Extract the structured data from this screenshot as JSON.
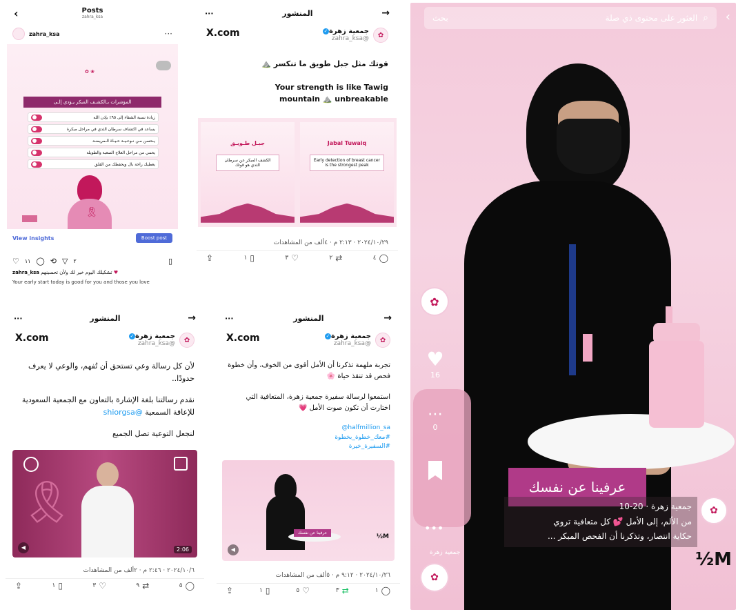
{
  "panel1": {
    "title": "Posts",
    "subtitle": "zahra_ksa",
    "account": "zahra_ksa",
    "banner": "المؤشرات بـالكشـف المبكر يـؤدي إلـى",
    "items": [
      "زيادة نسبة الشفاء إلى ٩٥٪ بإذن الله",
      "يساعد في اكتشاف سرطان الثدي في مراحل مبكرة",
      "يـحسن مـن نـوعـيـة حـيـاة الـمريضـة",
      "يحمي من مراحل العلاج الصعبة والطويلة",
      "يعطيك راحة بال ويحفظك من القلق"
    ],
    "view_insights": "View insights",
    "boost_post": "Boost post",
    "likes": "١١",
    "shares": "٢",
    "caption": "تشكيلك اليوم خير لك ولأن تحسينهم",
    "caption_en": "Your early start today is good for you and those you love"
  },
  "panel2": {
    "header_title": "المنشور",
    "xlogo": "X.com",
    "name": "جمعية زهرة",
    "handle": "@zahra_ksa",
    "text_ar": "قوتك مثل جبل طويق ما تنكسر ⛰️",
    "text_en": "Your strength is like Tawig mountain ⛰️ unbreakable",
    "img_left_title": "جبـل طـويـق",
    "img_right_title": "Jabal Tuwaiq",
    "img_left_body": "الكشف المبكر عن سرطان الثدي هو قوتك",
    "img_right_body": "Early detection of breast cancer is the strongest peak",
    "meta": "٢٠٢٤/١٠/٢٩ · ٢:١٣ م · ٤ألف من المشاهدات",
    "act_like": "٣",
    "act_rt": "٢",
    "act_reply": "٤",
    "act_book": "١"
  },
  "panel3": {
    "header_title": "المنشور",
    "xlogo": "X.com",
    "name": "جمعية زهرة",
    "handle": "@zahra_ksa",
    "line1": "لأن كل رسالة وعي تستحق أن تُفهم، والوعي لا يعرف حدودًا..",
    "line2": "نقدم رسالتنا بلغة الإشارة بالتعاون مع الجمعية السعودية للإعاقة السمعية",
    "mention": "@shiorgsa",
    "line3": "لنجعل التوعية تصل الجميع",
    "video_time": "2:06",
    "meta": "٢٠٢٤/١٠/٦ · ٢:٤٦ م · ٢ألف من المشاهدات",
    "act_like": "٣",
    "act_rt": "٩",
    "act_reply": "٥",
    "act_book": "١"
  },
  "panel4": {
    "header_title": "المنشور",
    "xlogo": "X.com",
    "name": "جمعية زهرة",
    "handle": "@zahra_ksa",
    "line1": "تجربة ملهمة تذكرنا أن الأمل أقوى من الخوف، وأن خطوة فحص قد تنقذ حياة 🌸",
    "line2": "استمعوا لرسالة سفيرة جمعية زهرة، المتعافية التي اختارت أن تكون صوت الأمل 💗",
    "tag1": "@halfmillion_sa",
    "tag2": "#معك_خطوة_بخطوة",
    "tag3": "#السفيرة_خيرة",
    "video_caption": "عرفينا عن نفسك",
    "video_brand": "½M",
    "meta": "٢٠٢٤/١٠/٢٦ · ٩:١٢ م · ٥ألف من المشاهدات",
    "act_like": "٥",
    "act_rt": "٣",
    "act_reply": "١",
    "act_book": "١"
  },
  "panel5": {
    "search_placeholder": "العثور على محتوى ذي صلة",
    "search_button": "بحث",
    "likes": "16",
    "comments": "0",
    "caption_banner": "عرفينا عن نفسك",
    "account_line": "جمعية زهرة · 20-10",
    "desc1": "من الألم، إلى الأمل 💕 كل متعافية تروي",
    "desc2": "حكاية انتصار، وتذكرنا أن الفحص المبكر ...",
    "brand": "½M",
    "side_label": "جمعية زهرة"
  },
  "colors": {
    "accent": "#c2185b",
    "banner": "#8e2a6b",
    "boost": "#4f6bd8"
  }
}
